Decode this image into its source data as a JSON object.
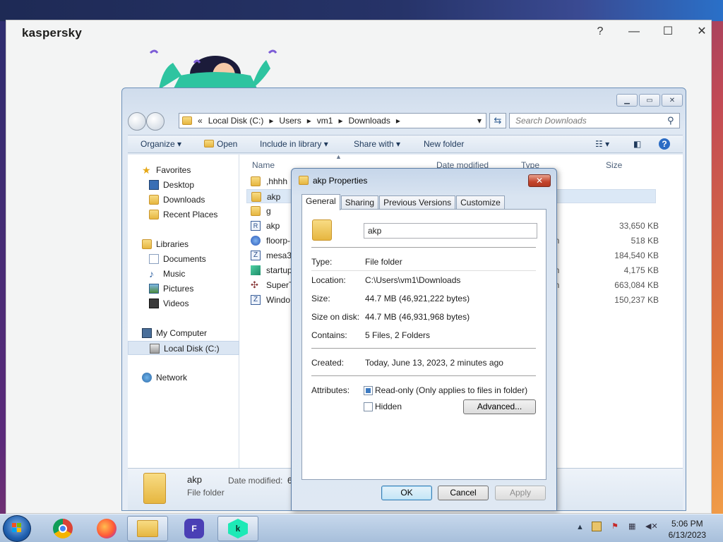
{
  "kaspersky": {
    "logo": "kaspersky",
    "help": "?",
    "minimize": "—",
    "maximize": "☐",
    "close": "✕"
  },
  "explorer": {
    "breadcrumb": [
      "Local Disk (C:)",
      "Users",
      "vm1",
      "Downloads"
    ],
    "search_placeholder": "Search Downloads",
    "toolbar": {
      "organize": "Organize",
      "open": "Open",
      "include": "Include in library",
      "share": "Share with",
      "new_folder": "New folder"
    },
    "nav": {
      "favorites": "Favorites",
      "desktop": "Desktop",
      "downloads": "Downloads",
      "recent": "Recent Places",
      "libraries": "Libraries",
      "documents": "Documents",
      "music": "Music",
      "pictures": "Pictures",
      "videos": "Videos",
      "computer": "My Computer",
      "localdisk": "Local Disk (C:)",
      "network": "Network"
    },
    "columns": {
      "name": "Name",
      "date": "Date modified",
      "type": "Type",
      "size": "Size"
    },
    "rows": [
      {
        "name": ",hhhh",
        "type": "",
        "size": ""
      },
      {
        "name": "akp",
        "type": "",
        "size": ""
      },
      {
        "name": "g",
        "type": "",
        "size": ""
      },
      {
        "name": "akp",
        "type": "e",
        "size": "33,650 KB"
      },
      {
        "name": "floorp-",
        "type": "on",
        "size": "518 KB"
      },
      {
        "name": "mesa3",
        "type": "",
        "size": "184,540 KB"
      },
      {
        "name": "startup",
        "type": "on",
        "size": "4,175 KB"
      },
      {
        "name": "SuperT",
        "type": "on",
        "size": "663,084 KB"
      },
      {
        "name": "Windo",
        "type": "e",
        "size": "150,237 KB"
      }
    ],
    "details": {
      "name": "akp",
      "type": "File folder",
      "date_label": "Date modified:",
      "date_value": "6/1"
    }
  },
  "dialog": {
    "title": "akp Properties",
    "close": "✕",
    "tabs": [
      "General",
      "Sharing",
      "Previous Versions",
      "Customize"
    ],
    "name_value": "akp",
    "fields": {
      "type_label": "Type:",
      "type_value": "File folder",
      "location_label": "Location:",
      "location_value": "C:\\Users\\vm1\\Downloads",
      "size_label": "Size:",
      "size_value": "44.7 MB (46,921,222 bytes)",
      "disk_label": "Size on disk:",
      "disk_value": "44.7 MB (46,931,968 bytes)",
      "contains_label": "Contains:",
      "contains_value": "5 Files, 2 Folders",
      "created_label": "Created:",
      "created_value": "Today, June 13, 2023, 2 minutes ago",
      "attributes_label": "Attributes:",
      "readonly_label": "Read-only (Only applies to files in folder)",
      "hidden_label": "Hidden",
      "advanced": "Advanced..."
    },
    "buttons": {
      "ok": "OK",
      "cancel": "Cancel",
      "apply": "Apply"
    }
  },
  "taskbar": {
    "time": "5:06 PM",
    "date": "6/13/2023"
  }
}
